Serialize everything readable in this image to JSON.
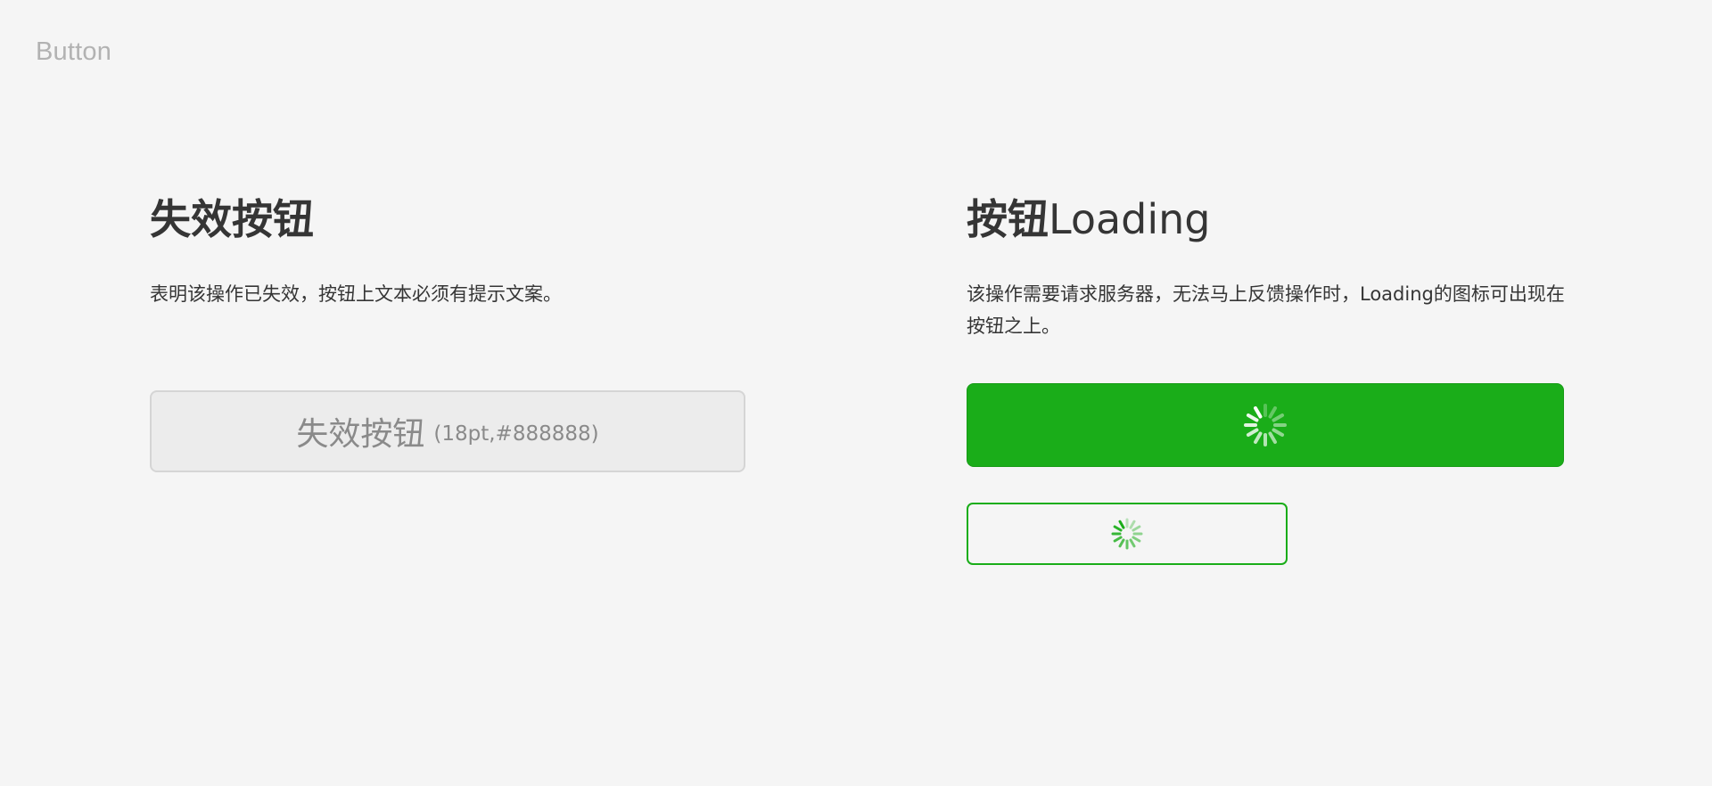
{
  "page": {
    "label": "Button"
  },
  "disabled_section": {
    "title": "失效按钮",
    "description": "表明该操作已失效，按钮上文本必须有提示文案。",
    "button": {
      "label": "失效按钮",
      "note": "(18pt,#888888)"
    }
  },
  "loading_section": {
    "title_bold": "按钮",
    "title_light": "Loading",
    "description": "该操作需要请求服务器，无法马上反馈操作时，Loading的图标可出现在按钮之上。",
    "primary_button": {
      "icon": "loading-spinner-icon"
    },
    "plain_button": {
      "icon": "loading-spinner-icon"
    }
  },
  "colors": {
    "background": "#f5f5f5",
    "primary": "#1aad19",
    "text": "#353535",
    "disabled_text": "#888888"
  }
}
